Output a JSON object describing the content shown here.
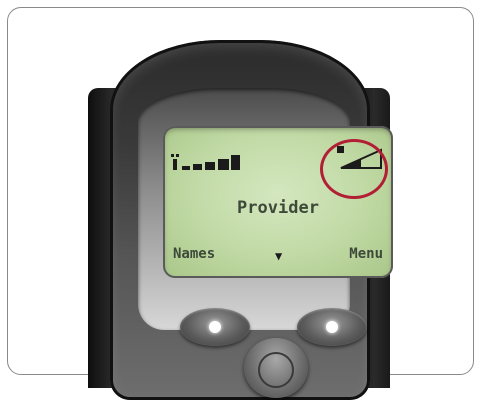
{
  "screen": {
    "provider_label": "Provider",
    "left_softkey": "Names",
    "right_softkey": "Menu",
    "scroll_indicator": "▼",
    "signal_icon": "signal-strength-icon",
    "battery_icon": "battery-level-icon"
  },
  "colors": {
    "lcd_background": "#c0d9a4",
    "lcd_text": "#3d4a3a",
    "highlight": "#b21e34"
  }
}
